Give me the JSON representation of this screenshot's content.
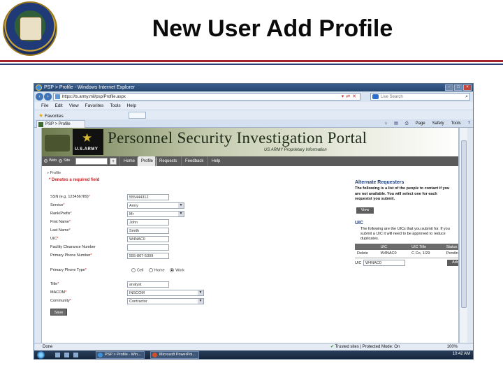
{
  "slide": {
    "title": "New User Add Profile",
    "accent_red": "#a3272a",
    "accent_blue": "#2c3f79"
  },
  "browser": {
    "window_title": "PSP > Profile - Windows Internet Explorer",
    "address": "https://ts.army.mil/psp/Profile.aspx",
    "search_placeholder": "Live Search",
    "menu": [
      "File",
      "Edit",
      "View",
      "Favorites",
      "Tools",
      "Help"
    ],
    "favorites_label": "Favorites",
    "tab_label": "PSP > Profile",
    "commands": [
      "Page",
      "Safety",
      "Tools"
    ],
    "status_left": "Done",
    "status_zone": "Trusted sites | Protected Mode: On",
    "zoom": "100%"
  },
  "portal": {
    "banner_title": "Personnel Security Investigation Portal",
    "banner_subtitle": "US ARMY Proprietary Information",
    "logo_text": "U.S.ARMY",
    "search_web": "Web",
    "search_site": "Site",
    "nav": [
      "Home",
      "Profile",
      "Requests",
      "Feedback",
      "Help"
    ],
    "breadcrumb": "» Profile",
    "required_note": "* Denotes a required field"
  },
  "form": {
    "ssn_label": "SSN (e.g. 123456789)",
    "ssn_value": "555444312",
    "service_label": "Service",
    "service_value": "Army",
    "rank_label": "Rank/Prefix",
    "rank_value": "Mr",
    "first_label": "First Name",
    "first_value": "John",
    "last_label": "Last Name",
    "last_value": "Smith",
    "uic_label": "UIC",
    "uic_value": "W4NAC0",
    "facility_label": "Facility Clearance Number",
    "facility_value": "",
    "phone_label": "Primary Phone Number",
    "phone_value": "555-867-5309",
    "phone_type_label": "Primary Phone Type",
    "phone_types": [
      "Cell",
      "Home",
      "Work"
    ],
    "title_label": "Title",
    "title_value": "analyst",
    "macom_label": "MACOM",
    "macom_value": "INSCOM",
    "community_label": "Community",
    "community_value": "Contractor",
    "save_label": "Save"
  },
  "sidebar": {
    "alt_title": "Alternate Requesters",
    "alt_text": "The following is a list of the people to contact if you are not available. You will select one for each requestst you submit.",
    "view_label": "View",
    "uic_title": "UIC",
    "uic_text": "The following are the UICs that you submit for. If you submit a UIC it will need to be approved to reduce duplicates.",
    "table_headers": [
      "",
      "UIC",
      "UIC Title",
      "Status"
    ],
    "table_rows": [
      [
        "Delete",
        "W4NAC0",
        "C Co, 1/29",
        "Pending"
      ]
    ],
    "uic_row_label": "UIC",
    "uic_input_value": "W4NAC0",
    "add_label": "Add"
  },
  "taskbar": {
    "items": [
      "PSP > Profile - Win...",
      "Microsoft PowerPoi..."
    ],
    "clock": "10:42 AM"
  }
}
